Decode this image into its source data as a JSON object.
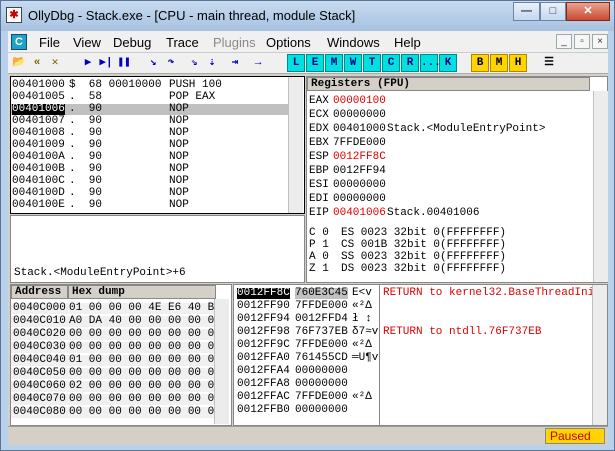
{
  "window": {
    "title": "OllyDbg - Stack.exe - [CPU - main thread, module Stack]",
    "app_icon": "bug-icon"
  },
  "menu": {
    "items": [
      "File",
      "View",
      "Debug",
      "Trace",
      "Plugins",
      "Options",
      "Windows",
      "Help"
    ],
    "disabled": "Plugins",
    "logo": "C"
  },
  "toolbar": {
    "icons": [
      "open-icon",
      "restart-icon",
      "close-icon",
      "run-icon",
      "step-run-icon",
      "pause-icon",
      "step-into-icon",
      "step-over-icon",
      "trace-into-icon",
      "trace-over-icon",
      "execute-till-return-icon",
      "go-to-user-code-icon"
    ],
    "letters": [
      "L",
      "E",
      "M",
      "W",
      "T",
      "C",
      "R",
      "...",
      "K"
    ],
    "colored": [
      "B",
      "M",
      "H"
    ]
  },
  "disasm": {
    "rows": [
      {
        "addr": "00401000",
        "hex": "$  68 00010000",
        "asm": "PUSH 100",
        "sel": false
      },
      {
        "addr": "00401005",
        "hex": ".  58",
        "asm": "POP EAX",
        "sel": false
      },
      {
        "addr": "00401006",
        "hex": ".  90",
        "asm": "NOP",
        "sel": true
      },
      {
        "addr": "00401007",
        "hex": ".  90",
        "asm": "NOP",
        "sel": false
      },
      {
        "addr": "00401008",
        "hex": ".  90",
        "asm": "NOP",
        "sel": false
      },
      {
        "addr": "00401009",
        "hex": ".  90",
        "asm": "NOP",
        "sel": false
      },
      {
        "addr": "0040100A",
        "hex": ".  90",
        "asm": "NOP",
        "sel": false
      },
      {
        "addr": "0040100B",
        "hex": ".  90",
        "asm": "NOP",
        "sel": false
      },
      {
        "addr": "0040100C",
        "hex": ".  90",
        "asm": "NOP",
        "sel": false
      },
      {
        "addr": "0040100D",
        "hex": ".  90",
        "asm": "NOP",
        "sel": false
      },
      {
        "addr": "0040100E",
        "hex": ".  90",
        "asm": "NOP",
        "sel": false
      }
    ],
    "info": "Stack.<ModuleEntryPoint>+6"
  },
  "registers": {
    "header": "Registers (FPU)",
    "gp": [
      {
        "name": "EAX",
        "value": "00000100",
        "extra": "",
        "changed": true
      },
      {
        "name": "ECX",
        "value": "00000000",
        "extra": "",
        "changed": false
      },
      {
        "name": "EDX",
        "value": "00401000",
        "extra": "Stack.<ModuleEntryPoint>",
        "changed": false
      },
      {
        "name": "EBX",
        "value": "7FFDE000",
        "extra": "",
        "changed": false
      },
      {
        "name": "ESP",
        "value": "0012FF8C",
        "extra": "",
        "changed": true
      },
      {
        "name": "EBP",
        "value": "0012FF94",
        "extra": "",
        "changed": false
      },
      {
        "name": "ESI",
        "value": "00000000",
        "extra": "",
        "changed": false
      },
      {
        "name": "EDI",
        "value": "00000000",
        "extra": "",
        "changed": false
      }
    ],
    "eip": {
      "name": "EIP",
      "value": "00401006",
      "extra": "Stack.00401006"
    },
    "flags": [
      {
        "f": "C 0",
        "seg": "ES 0023 32bit 0(FFFFFFFF)"
      },
      {
        "f": "P 1",
        "seg": "CS 001B 32bit 0(FFFFFFFF)"
      },
      {
        "f": "A 0",
        "seg": "SS 0023 32bit 0(FFFFFFFF)"
      },
      {
        "f": "Z 1",
        "seg": "DS 0023 32bit 0(FFFFFFFF)"
      }
    ]
  },
  "dump": {
    "col_address": "Address",
    "col_hex": "Hex dump",
    "rows": [
      {
        "addr": "0040C000",
        "hex": "01 00 00 00 4E E6 40 BB"
      },
      {
        "addr": "0040C010",
        "hex": "A0 DA 40 00 00 00 00 00"
      },
      {
        "addr": "0040C020",
        "hex": "00 00 00 00 00 00 00 00"
      },
      {
        "addr": "0040C030",
        "hex": "00 00 00 00 00 00 00 00"
      },
      {
        "addr": "0040C040",
        "hex": "01 00 00 00 00 00 00 00"
      },
      {
        "addr": "0040C050",
        "hex": "00 00 00 00 00 00 00 00"
      },
      {
        "addr": "0040C060",
        "hex": "02 00 00 00 00 00 00 00"
      },
      {
        "addr": "0040C070",
        "hex": "00 00 00 00 00 00 00 00"
      },
      {
        "addr": "0040C080",
        "hex": "00 00 00 00 00 00 00 00"
      }
    ]
  },
  "stack": {
    "rows": [
      {
        "addr": "0012FF8C",
        "val": "760E3C45",
        "chr": "E<v",
        "comment": "RETURN to kernel32.BaseThreadInitThu",
        "sel": true
      },
      {
        "addr": "0012FF90",
        "val": "7FFDE000",
        "chr": "«²Δ",
        "comment": "",
        "sel": false
      },
      {
        "addr": "0012FF94",
        "val": "0012FFD4",
        "chr": "ł ↕",
        "comment": "",
        "sel": false
      },
      {
        "addr": "0012FF98",
        "val": "76F737EB",
        "chr": "δ7≈v",
        "comment": "RETURN to ntdll.76F737EB",
        "sel": false
      },
      {
        "addr": "0012FF9C",
        "val": "7FFDE000",
        "chr": "«²Δ",
        "comment": "",
        "sel": false
      },
      {
        "addr": "0012FFA0",
        "val": "761455CD",
        "chr": "═U¶v",
        "comment": "",
        "sel": false
      },
      {
        "addr": "0012FFA4",
        "val": "00000000",
        "chr": "",
        "comment": "",
        "sel": false
      },
      {
        "addr": "0012FFA8",
        "val": "00000000",
        "chr": "",
        "comment": "",
        "sel": false
      },
      {
        "addr": "0012FFAC",
        "val": "7FFDE000",
        "chr": "«²Δ",
        "comment": "",
        "sel": false
      },
      {
        "addr": "0012FFB0",
        "val": "00000000",
        "chr": "",
        "comment": "",
        "sel": false
      }
    ]
  },
  "status": {
    "state": "Paused"
  }
}
